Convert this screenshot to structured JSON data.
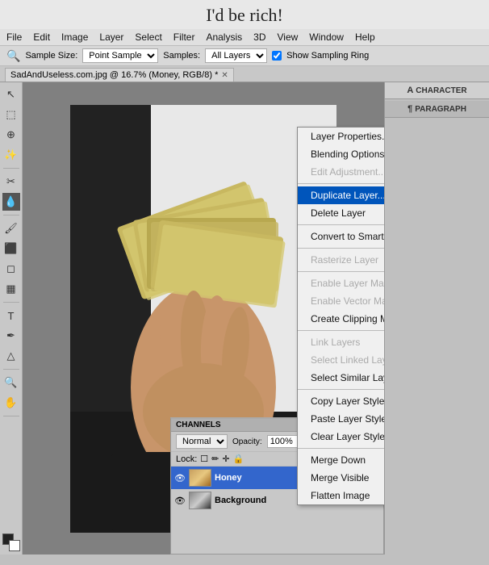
{
  "title": "I'd be rich!",
  "menubar": {
    "items": [
      "File",
      "Edit",
      "Image",
      "Layer",
      "Select",
      "Filter",
      "Analysis",
      "3D",
      "View",
      "Window",
      "Help"
    ]
  },
  "toolbar": {
    "tool_icon": "🔻",
    "sample_size_label": "Sample Size:",
    "sample_size_value": "Point Sample",
    "samples_label": "Samples:",
    "samples_value": "All Layers",
    "show_sampling_ring_label": "Show Sampling Ring"
  },
  "tab": {
    "filename": "SadAndUseless.com.jpg @ 16.7% (Money, RGB/8) *"
  },
  "right_panel": {
    "tabs": [
      {
        "id": "character",
        "label": "CHARACTER",
        "icon": "A"
      },
      {
        "id": "paragraph",
        "label": "PARAGRAPH",
        "icon": "¶"
      }
    ]
  },
  "context_menu": {
    "items": [
      {
        "id": "layer-properties",
        "label": "Layer Properties...",
        "disabled": false,
        "highlighted": false,
        "separator_after": false
      },
      {
        "id": "blending-options",
        "label": "Blending Options...",
        "disabled": false,
        "highlighted": false,
        "separator_after": false
      },
      {
        "id": "edit-adjustment",
        "label": "Edit Adjustment...",
        "disabled": true,
        "highlighted": false,
        "separator_after": true
      },
      {
        "id": "duplicate-layer",
        "label": "Duplicate Layer...",
        "disabled": false,
        "highlighted": true,
        "separator_after": false
      },
      {
        "id": "delete-layer",
        "label": "Delete Layer",
        "disabled": false,
        "highlighted": false,
        "separator_after": true
      },
      {
        "id": "convert-smart",
        "label": "Convert to Smart Object",
        "disabled": false,
        "highlighted": false,
        "separator_after": true
      },
      {
        "id": "rasterize-layer",
        "label": "Rasterize Layer",
        "disabled": true,
        "highlighted": false,
        "separator_after": true
      },
      {
        "id": "enable-layer-mask",
        "label": "Enable Layer Mask",
        "disabled": true,
        "highlighted": false,
        "separator_after": false
      },
      {
        "id": "enable-vector-mask",
        "label": "Enable Vector Mask",
        "disabled": true,
        "highlighted": false,
        "separator_after": false
      },
      {
        "id": "create-clipping-mask",
        "label": "Create Clipping Mask",
        "disabled": false,
        "highlighted": false,
        "separator_after": true
      },
      {
        "id": "link-layers",
        "label": "Link Layers",
        "disabled": true,
        "highlighted": false,
        "separator_after": false
      },
      {
        "id": "select-linked",
        "label": "Select Linked Layers",
        "disabled": true,
        "highlighted": false,
        "separator_after": false
      },
      {
        "id": "select-similar",
        "label": "Select Similar Layers",
        "disabled": false,
        "highlighted": false,
        "separator_after": true
      },
      {
        "id": "copy-layer-style",
        "label": "Copy Layer Style",
        "disabled": false,
        "highlighted": false,
        "separator_after": false
      },
      {
        "id": "paste-layer-style",
        "label": "Paste Layer Style",
        "disabled": false,
        "highlighted": false,
        "separator_after": false
      },
      {
        "id": "clear-layer-style",
        "label": "Clear Layer Style",
        "disabled": false,
        "highlighted": false,
        "separator_after": true
      },
      {
        "id": "merge-down",
        "label": "Merge Down",
        "disabled": false,
        "highlighted": false,
        "separator_after": false
      },
      {
        "id": "merge-visible",
        "label": "Merge Visible",
        "disabled": false,
        "highlighted": false,
        "separator_after": false
      },
      {
        "id": "flatten-image",
        "label": "Flatten Image",
        "disabled": false,
        "highlighted": false,
        "separator_after": false
      }
    ]
  },
  "layers_panel": {
    "header": "CHANNELS",
    "blend_mode": "Normal",
    "opacity_label": "",
    "lock_label": "Lock:",
    "layers": [
      {
        "id": "honey",
        "name": "Honey",
        "visible": true,
        "selected": true,
        "locked": false
      },
      {
        "id": "background",
        "name": "Background",
        "visible": true,
        "selected": false,
        "locked": true
      }
    ]
  },
  "tools": [
    "↖",
    "✂",
    "⬚",
    "⊕",
    "✏",
    "🖌",
    "⟨⟩",
    "🔍",
    "T",
    "🖊",
    "📐",
    "⬛"
  ]
}
